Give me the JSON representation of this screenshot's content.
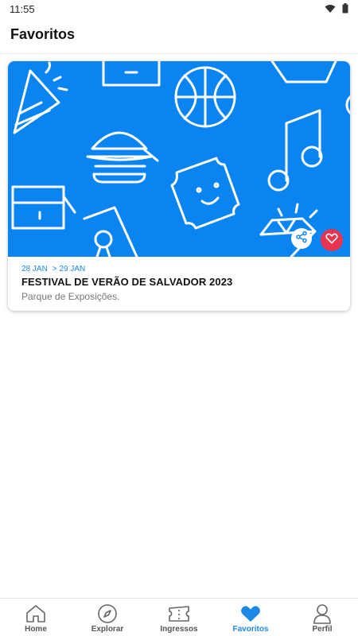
{
  "status_bar": {
    "time": "11:55",
    "wifi_icon": "wifi-icon",
    "battery_icon": "battery-icon"
  },
  "header": {
    "title": "Favoritos"
  },
  "favorites": [
    {
      "date_start": "28 JAN",
      "date_end": "> 29 JAN",
      "title": "FESTIVAL DE VERÃO DE SALVADOR 2023",
      "venue": "Parque de Exposições.",
      "banner_color": "#0a84f0",
      "favorite_color": "#e8344e"
    }
  ],
  "bottom_nav": {
    "items": [
      {
        "label": "Home",
        "icon": "home-icon"
      },
      {
        "label": "Explorar",
        "icon": "compass-icon"
      },
      {
        "label": "Ingressos",
        "icon": "ticket-icon"
      },
      {
        "label": "Favoritos",
        "icon": "heart-icon",
        "active": true
      },
      {
        "label": "Perfil",
        "icon": "user-icon"
      }
    ],
    "active_color": "#1e88e5"
  }
}
